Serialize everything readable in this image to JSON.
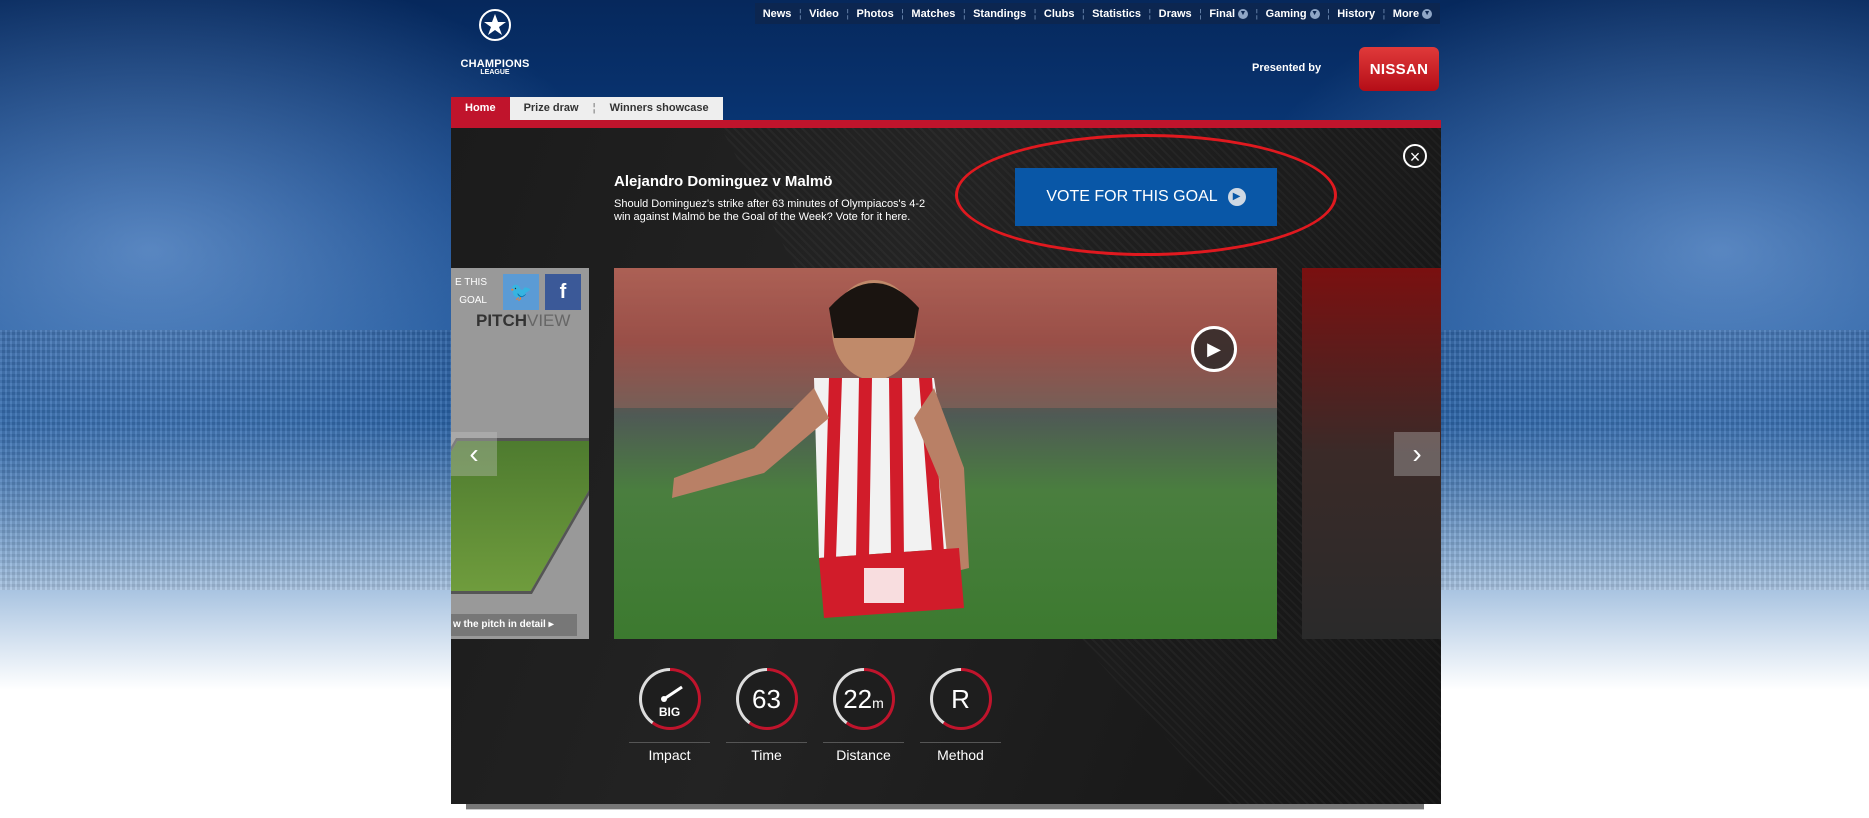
{
  "header": {
    "logo": {
      "title": "CHAMPIONS",
      "subtitle": "LEAGUE",
      "icon": "starball-icon"
    },
    "nav": [
      {
        "label": "News"
      },
      {
        "label": "Video"
      },
      {
        "label": "Photos"
      },
      {
        "label": "Matches"
      },
      {
        "label": "Standings"
      },
      {
        "label": "Clubs"
      },
      {
        "label": "Statistics"
      },
      {
        "label": "Draws"
      },
      {
        "label": "Final"
      },
      {
        "label": "Gaming"
      },
      {
        "label": "History"
      },
      {
        "label": "More"
      }
    ],
    "presented_by": "Presented by",
    "sponsor": "NISSAN"
  },
  "subtabs": [
    {
      "label": "Home",
      "active": true
    },
    {
      "label": "Prize draw",
      "active": false
    },
    {
      "label": "Winners showcase",
      "active": false
    }
  ],
  "goal": {
    "title": "Alejandro Dominguez v Malmö",
    "description": "Should Dominguez's strike after 63 minutes of Olympiacos's 4-2 win against Malmö be the Goal of the Week? Vote for it here.",
    "vote_button": "VOTE FOR THIS GOAL"
  },
  "left_card": {
    "share_text_1": "E THIS",
    "share_text_2": "GOAL",
    "pitchview_a": "PITCH",
    "pitchview_b": "VIEW",
    "detail_link": "w the pitch in detail"
  },
  "stats": [
    {
      "value": "",
      "sub": "BIG",
      "label": "Impact"
    },
    {
      "value": "63",
      "label": "Time"
    },
    {
      "value": "22",
      "unit": "m",
      "label": "Distance"
    },
    {
      "value": "R",
      "label": "Method"
    }
  ],
  "colors": {
    "accent_red": "#c0142c",
    "vote_blue": "#0957a7",
    "nav_bg": "#0c2650",
    "highlight_ellipse": "#e0191f"
  }
}
